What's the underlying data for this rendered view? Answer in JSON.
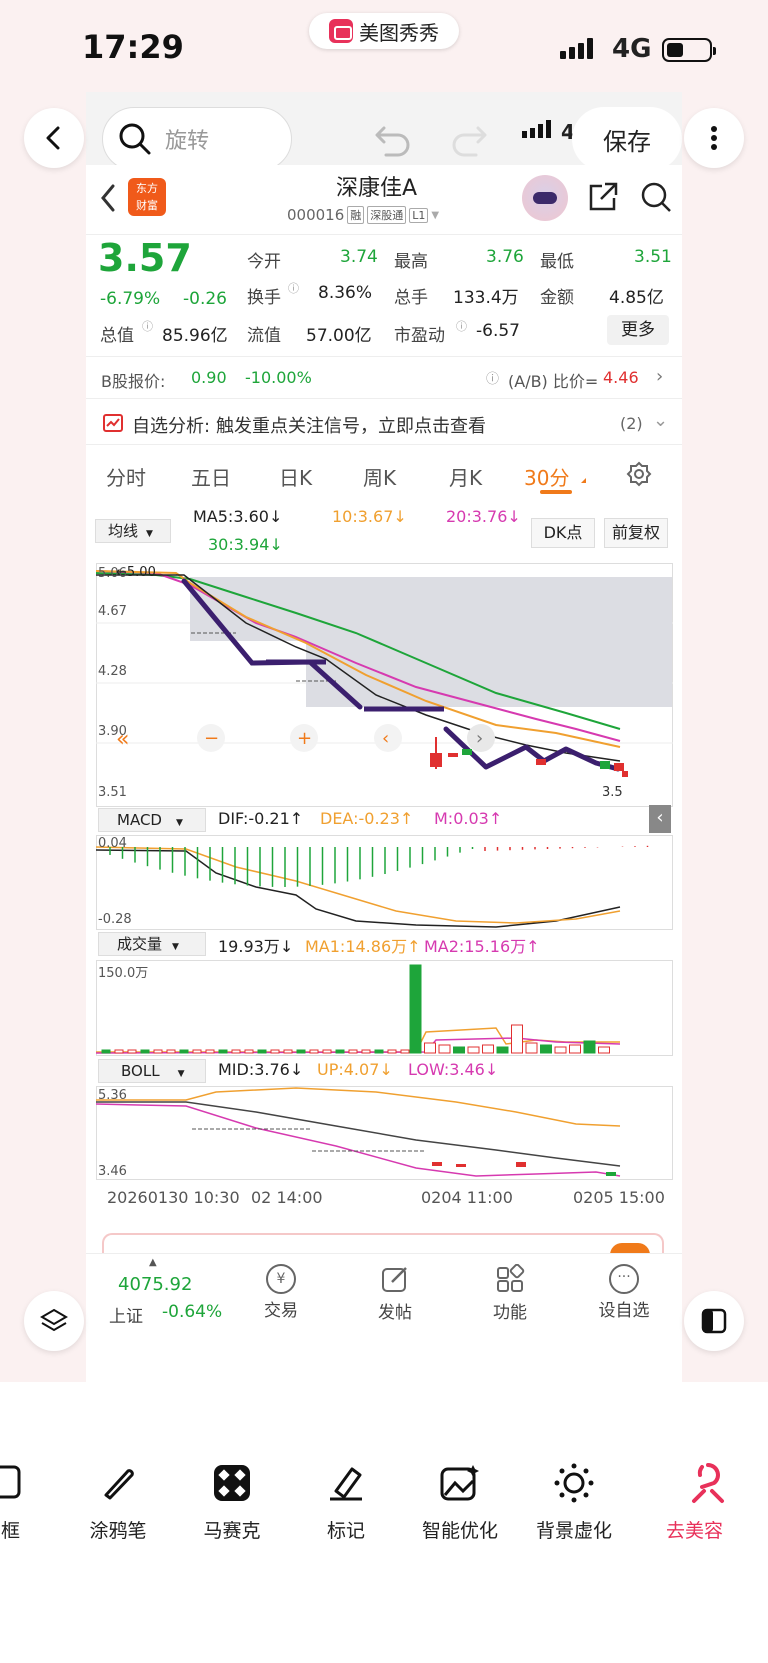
{
  "status_bar": {
    "time": "17:29",
    "app_name": "美图秀秀",
    "network": "4G"
  },
  "editor": {
    "search_placeholder": "旋转",
    "save_label": "保存",
    "net_partial": "4"
  },
  "stock": {
    "name": "深康佳A",
    "code": "000016",
    "tags": [
      "融",
      "深股通",
      "L1"
    ],
    "price": "3.57",
    "change_pct": "-6.79%",
    "change": "-0.26",
    "quotes": [
      {
        "label": "今开",
        "value": "3.74",
        "color": "green"
      },
      {
        "label": "最高",
        "value": "3.76",
        "color": "green"
      },
      {
        "label": "最低",
        "value": "3.51",
        "color": "green"
      },
      {
        "label": "换手",
        "value": "8.36%",
        "color": "dark"
      },
      {
        "label": "总手",
        "value": "133.4万",
        "color": "dark"
      },
      {
        "label": "金额",
        "value": "4.85亿",
        "color": "dark"
      },
      {
        "label": "总值",
        "value": "85.96亿",
        "color": "dark"
      },
      {
        "label": "流值",
        "value": "57.00亿",
        "color": "dark"
      },
      {
        "label": "市盈动",
        "value": "-6.57",
        "color": "dark"
      }
    ],
    "more": "更多",
    "b_share_label": "B股报价:",
    "b_share_price": "0.90",
    "b_share_pct": "-10.00%",
    "ab_ratio_label": "(A/B) 比价=",
    "ab_ratio": "4.46",
    "analysis_label": "自选分析:",
    "analysis_text": "触发重点关注信号，立即点击查看",
    "analysis_count": "(2)"
  },
  "chart_tabs": [
    "分时",
    "五日",
    "日K",
    "周K",
    "月K",
    "30分"
  ],
  "active_tab": "30分",
  "ma": {
    "selector": "均线",
    "ma5": "MA5:3.60",
    "ma10": "10:3.67",
    "ma20": "20:3.76",
    "ma30": "30:3.94",
    "dk": "DK点",
    "fq": "前复权"
  },
  "kline": {
    "y_labels": [
      "5.06",
      "4.67",
      "4.28",
      "3.90",
      "3.51"
    ],
    "high_label": "5.00",
    "last_label": "3.5"
  },
  "macd": {
    "name": "MACD",
    "dif": "DIF:-0.21",
    "dea": "DEA:-0.23",
    "m": "M:0.03",
    "y_top": "0.04",
    "y_bottom": "-0.28"
  },
  "volume": {
    "name": "成交量",
    "value": "19.93万",
    "ma1": "MA1:14.86万",
    "ma2": "MA2:15.16万",
    "y_top": "150.0万"
  },
  "boll": {
    "name": "BOLL",
    "mid": "MID:3.76",
    "up": "UP:4.07",
    "low": "LOW:3.46",
    "y_top": "5.36",
    "y_bottom": "3.46"
  },
  "x_labels": [
    "20260130 10:30",
    "02 14:00",
    "0204 11:00",
    "0205 15:00"
  ],
  "bottom_nav": {
    "index_value": "4075.92",
    "index_name": "上证",
    "index_pct": "-0.64%",
    "items": [
      "交易",
      "发帖",
      "功能",
      "设自选"
    ]
  },
  "toolbar": [
    "框",
    "涂鸦笔",
    "马赛克",
    "标记",
    "智能优化",
    "背景虚化",
    "去美容"
  ],
  "colors": {
    "up": "#e03030",
    "down": "#1ea53a",
    "accent": "#f07a1a",
    "brand": "#e8315a"
  }
}
